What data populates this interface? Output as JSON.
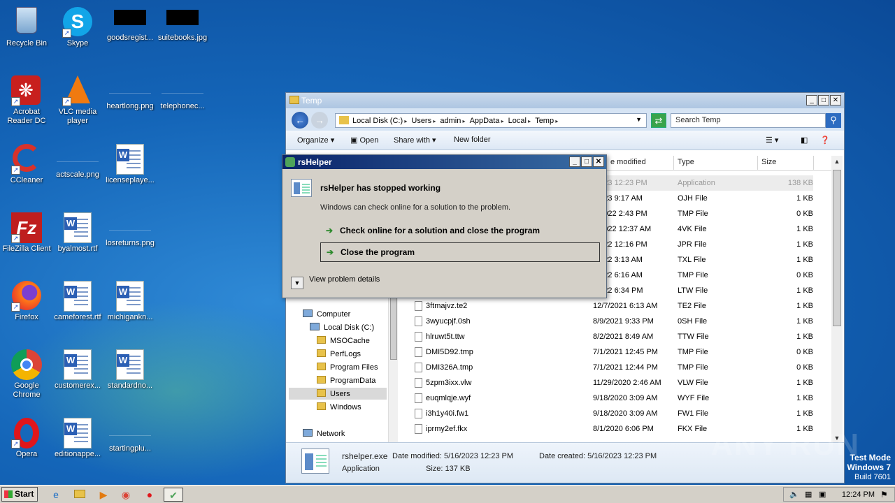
{
  "desktop": {
    "icons": [
      {
        "label": "Recycle Bin"
      },
      {
        "label": "Skype"
      },
      {
        "label": "goodsregist..."
      },
      {
        "label": "suitebooks.jpg"
      },
      {
        "label": "Acrobat Reader DC"
      },
      {
        "label": "VLC media player"
      },
      {
        "label": "heartlong.png"
      },
      {
        "label": "telephonec..."
      },
      {
        "label": "CCleaner"
      },
      {
        "label": "actscale.png"
      },
      {
        "label": "licenseplaye..."
      },
      {
        "label": "FileZilla Client"
      },
      {
        "label": "byalmost.rtf"
      },
      {
        "label": "losreturns.png"
      },
      {
        "label": "Firefox"
      },
      {
        "label": "cameforest.rtf"
      },
      {
        "label": "michigankn..."
      },
      {
        "label": "Google Chrome"
      },
      {
        "label": "customerex..."
      },
      {
        "label": "standardno..."
      },
      {
        "label": "Opera"
      },
      {
        "label": "editionappe..."
      },
      {
        "label": "startingplu..."
      }
    ]
  },
  "explorer": {
    "title": "Temp",
    "address": [
      "Local Disk (C:)",
      "Users",
      "admin",
      "AppData",
      "Local",
      "Temp"
    ],
    "search_placeholder": "Search Temp",
    "toolbar": {
      "organize": "Organize",
      "open": "Open",
      "share_with": "Share with",
      "new_folder": "New folder"
    },
    "columns": {
      "date": "e modified",
      "type": "Type",
      "size": "Size"
    },
    "nav": [
      {
        "label": "Computer"
      },
      {
        "label": "Local Disk (C:)"
      },
      {
        "label": "MSOCache"
      },
      {
        "label": "PerfLogs"
      },
      {
        "label": "Program Files"
      },
      {
        "label": "ProgramData"
      },
      {
        "label": "Users"
      },
      {
        "label": "Windows"
      },
      {
        "label": "Network"
      }
    ],
    "files": [
      {
        "name": "",
        "date": "/2023 12:23 PM",
        "type": "Application",
        "size": "138 KB"
      },
      {
        "name": "",
        "date": "/2023 9:17 AM",
        "type": "OJH File",
        "size": "1 KB"
      },
      {
        "name": "",
        "date": "7/2022 2:43 PM",
        "type": "TMP File",
        "size": "0 KB"
      },
      {
        "name": "",
        "date": "9/2022 12:37 AM",
        "type": "4VK File",
        "size": "1 KB"
      },
      {
        "name": "",
        "date": "/2022 12:16 PM",
        "type": "JPR File",
        "size": "1 KB"
      },
      {
        "name": "",
        "date": "/2022 3:13 AM",
        "type": "TXL File",
        "size": "1 KB"
      },
      {
        "name": "",
        "date": "/2022 6:16 AM",
        "type": "TMP File",
        "size": "0 KB"
      },
      {
        "name": "",
        "date": "/2022 6:34 PM",
        "type": "LTW File",
        "size": "1 KB"
      },
      {
        "name": "3ftmajvz.te2",
        "date": "12/7/2021 6:13 AM",
        "type": "TE2 File",
        "size": "1 KB"
      },
      {
        "name": "3wyucpjf.0sh",
        "date": "8/9/2021 9:33 PM",
        "type": "0SH File",
        "size": "1 KB"
      },
      {
        "name": "hlruwt5t.ttw",
        "date": "8/2/2021 8:49 AM",
        "type": "TTW File",
        "size": "1 KB"
      },
      {
        "name": "DMI5D92.tmp",
        "date": "7/1/2021 12:45 PM",
        "type": "TMP File",
        "size": "0 KB"
      },
      {
        "name": "DMI326A.tmp",
        "date": "7/1/2021 12:44 PM",
        "type": "TMP File",
        "size": "0 KB"
      },
      {
        "name": "5zpm3ixx.vlw",
        "date": "11/29/2020 2:46 AM",
        "type": "VLW File",
        "size": "1 KB"
      },
      {
        "name": "euqmlqje.wyf",
        "date": "9/18/2020 3:09 AM",
        "type": "WYF File",
        "size": "1 KB"
      },
      {
        "name": "i3h1y40i.fw1",
        "date": "9/18/2020 3:09 AM",
        "type": "FW1 File",
        "size": "1 KB"
      },
      {
        "name": "iprmy2ef.fkx",
        "date": "8/1/2020 6:06 PM",
        "type": "FKX File",
        "size": "1 KB"
      }
    ],
    "details": {
      "name": "rshelper.exe",
      "modified_label": "Date modified: 5/16/2023 12:23 PM",
      "created_label": "Date created: 5/16/2023 12:23 PM",
      "type": "Application",
      "size_label": "Size: 137 KB"
    }
  },
  "dialog": {
    "title": "rsHelper",
    "heading": "rsHelper has stopped working",
    "message": "Windows can check online for a solution to the problem.",
    "option1": "Check online for a solution and close the program",
    "option2": "Close the program",
    "details": "View problem details"
  },
  "taskbar": {
    "start": "Start",
    "clock": "12:24 PM"
  },
  "watermark": "ANY RUN",
  "testmode": {
    "line1": "Test Mode",
    "line2": "Windows 7",
    "line3": "Build 7601"
  }
}
